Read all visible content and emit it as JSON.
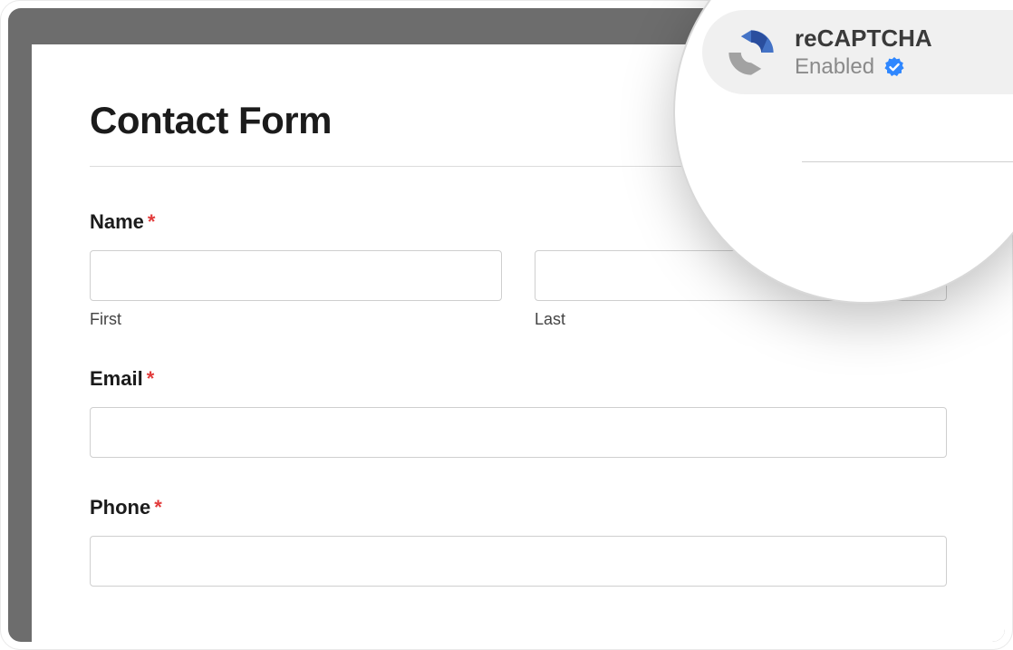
{
  "page": {
    "title": "Contact Form"
  },
  "form": {
    "name": {
      "label": "Name",
      "required": "*",
      "first_sub": "First",
      "last_sub": "Last",
      "first_value": "",
      "last_value": ""
    },
    "email": {
      "label": "Email",
      "required": "*",
      "value": ""
    },
    "phone": {
      "label": "Phone",
      "required": "*",
      "value": ""
    }
  },
  "recaptcha_badge": {
    "title": "reCAPTCHA",
    "status": "Enabled",
    "icon_name": "recaptcha-icon",
    "verified_icon_name": "verified-badge-icon",
    "colors": {
      "blue": "#4473c6",
      "dark_blue": "#2a4e9e",
      "gray": "#a2a2a2",
      "verified_blue": "#2f87ff"
    }
  }
}
